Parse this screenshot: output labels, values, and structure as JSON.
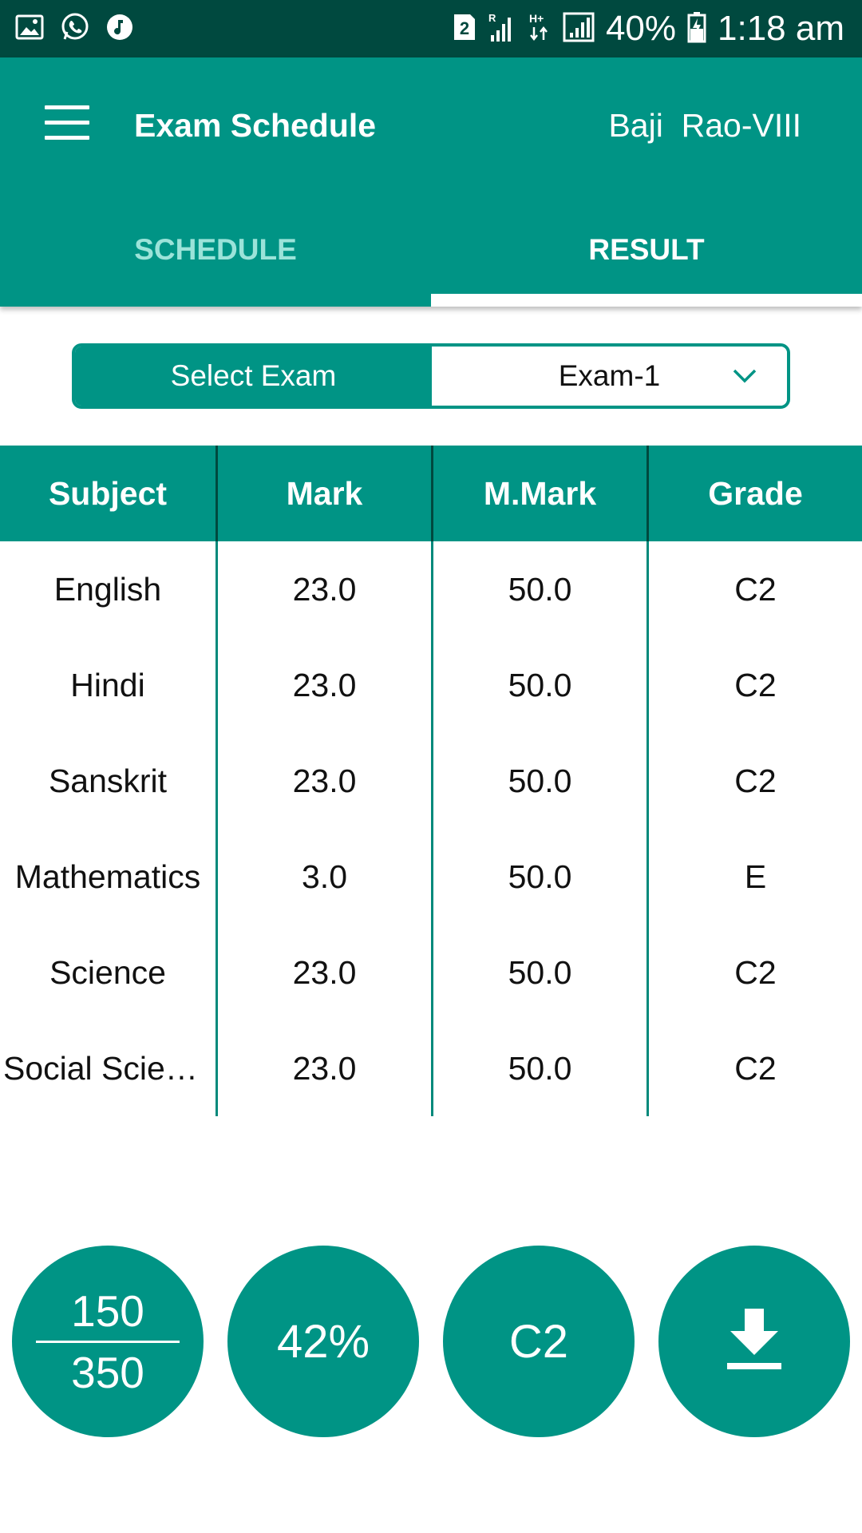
{
  "status_bar": {
    "battery": "40%",
    "time": "1:18 am",
    "sim_badge": "2",
    "network_label": "H+"
  },
  "app_bar": {
    "title": "Exam Schedule",
    "user": "Baji  Rao-VIII"
  },
  "tabs": [
    {
      "label": "SCHEDULE",
      "active": false
    },
    {
      "label": "RESULT",
      "active": true
    }
  ],
  "exam_select": {
    "label": "Select Exam",
    "value": "Exam-1"
  },
  "table": {
    "headers": [
      "Subject",
      "Mark",
      "M.Mark",
      "Grade"
    ],
    "rows": [
      {
        "subject": "English",
        "mark": "23.0",
        "max_mark": "50.0",
        "grade": "C2"
      },
      {
        "subject": "Hindi",
        "mark": "23.0",
        "max_mark": "50.0",
        "grade": "C2"
      },
      {
        "subject": "Sanskrit",
        "mark": "23.0",
        "max_mark": "50.0",
        "grade": "C2"
      },
      {
        "subject": "Mathematics",
        "mark": "3.0",
        "max_mark": "50.0",
        "grade": "E"
      },
      {
        "subject": "Science",
        "mark": "23.0",
        "max_mark": "50.0",
        "grade": "C2"
      },
      {
        "subject": "Social Scien…",
        "mark": "23.0",
        "max_mark": "50.0",
        "grade": "C2"
      }
    ]
  },
  "summary": {
    "obtained": "150",
    "total": "350",
    "percentage": "42%",
    "grade": "C2"
  },
  "colors": {
    "primary": "#009485",
    "status_bar": "#00493f",
    "tab_inactive": "#9be3d9"
  }
}
